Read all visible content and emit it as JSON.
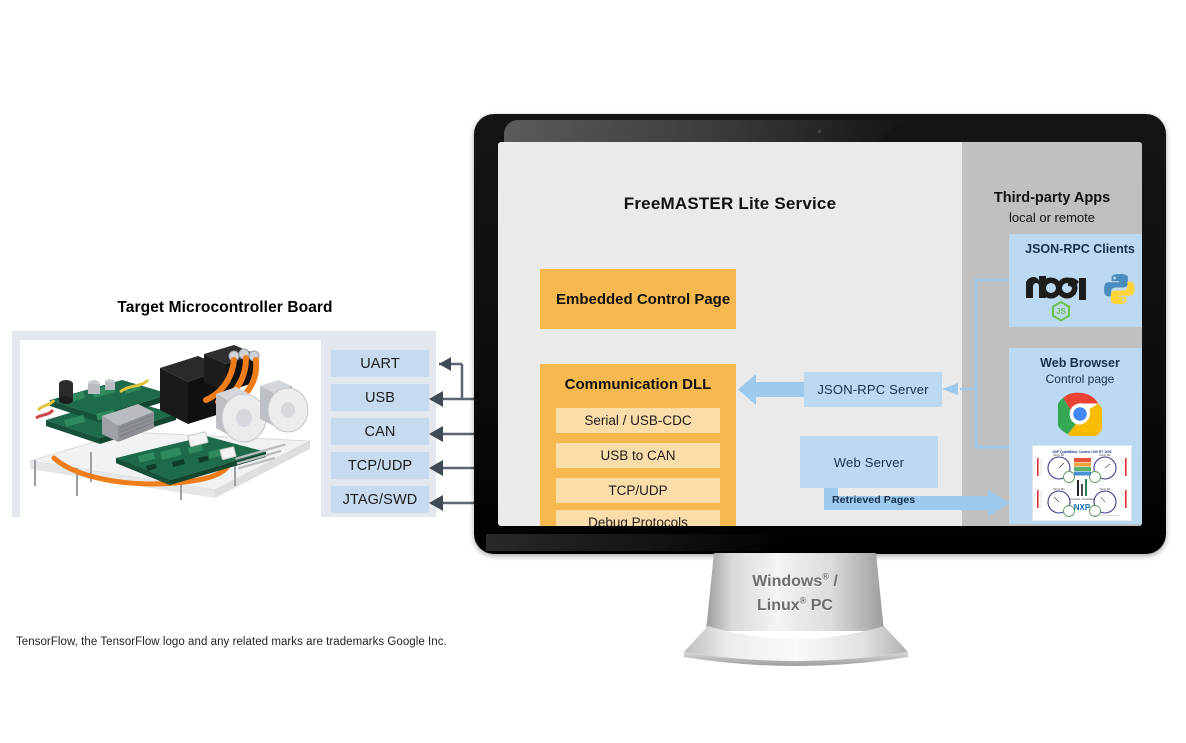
{
  "left_section": {
    "title": "Target Microcontroller Board",
    "board_photo_alt": "target-microcontroller-board-photo",
    "interfaces": [
      {
        "label": "UART"
      },
      {
        "label": "USB"
      },
      {
        "label": "CAN"
      },
      {
        "label": "TCP/UDP"
      },
      {
        "label": "JTAG/SWD"
      }
    ]
  },
  "screen": {
    "title": "FreeMASTER Lite Service",
    "embedded_control_page": "Embedded Control Page",
    "communication_dll": {
      "title": "Communication DLL",
      "protocols": [
        {
          "label": "Serial / USB-CDC"
        },
        {
          "label": "USB to CAN"
        },
        {
          "label": "TCP/UDP"
        },
        {
          "label": "Debug Protocols"
        }
      ]
    },
    "middle": {
      "json_rpc_server": "JSON-RPC Server",
      "web_server": "Web Server",
      "retrieved_pages": "Retrieved Pages"
    },
    "third_party": {
      "title": "Third-party Apps",
      "subtitle": "local or remote",
      "json_rpc_clients": {
        "label": "JSON-RPC Clients",
        "logos": [
          "nodejs-logo",
          "python-logo"
        ]
      },
      "web_browser": {
        "label_line1": "Web Browser",
        "label_line2": "Control page",
        "logos": [
          "chrome-logo"
        ],
        "thumbnail_alt": "nxp-quadmotor-control-page-thumbnail"
      }
    }
  },
  "stand": {
    "line1": "Windows",
    "line1_sup": "®",
    "line1_tail": " /",
    "line2": "Linux",
    "line2_sup": "®",
    "line2_tail": " PC"
  },
  "footer": {
    "trademark": "TensorFlow, the TensorFlow logo and any related marks are trademarks Google Inc."
  },
  "colors": {
    "orange": "#F6B94F",
    "orange_light": "#FBDDAA",
    "blue": "#BCD9F2",
    "blue_iface": "#C6DBF0",
    "panel_gray": "#E3E8EF",
    "screen_gray": "#EAEAEA",
    "screen_right_gray": "#C0C0C0",
    "arrow_dark": "#3F4A55",
    "connector_blue": "#9CC9EC"
  }
}
